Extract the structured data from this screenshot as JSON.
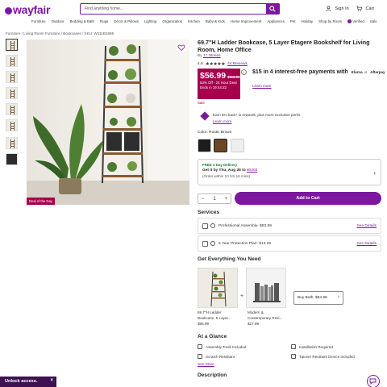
{
  "header": {
    "logo": "wayfair",
    "search_placeholder": "Find anything home...",
    "sign_in": "Sign In",
    "cart": "Cart"
  },
  "nav": [
    "Furniture",
    "Outdoor",
    "Bedding & Bath",
    "Rugs",
    "Décor & Pillows",
    "Lighting",
    "Organization",
    "Kitchen",
    "Baby & Kids",
    "Home Improvement",
    "Appliances",
    "Pet",
    "Holiday",
    "Shop by Room",
    "Verified",
    "Sale"
  ],
  "breadcrumb": "Furniture / Living Room Furniture / Bookcases / SKU: W111B1685",
  "product": {
    "title": "69.7\"H Ladder Bookcase, 5 Layer Etagere Bookshelf for Living Room, Home Office",
    "by_prefix": "By",
    "brand": "17 Stories",
    "rating": "4.8",
    "stars": "★★★★★",
    "reviews": "44 Reviews",
    "price": "$56.99",
    "old_price": "$119.99",
    "discount": "53% Off - 24 Hour Deal",
    "ends": "Ends in 19:44:22",
    "sale": "Sale",
    "installment": "$15 in 4 interest-free payments with",
    "klarna": "Klarna",
    "or": "or",
    "afterpay": "Afterpay",
    "learn_more": "Learn more",
    "rewards": "Earn 5% back* in rewards, plus more exclusive perks",
    "rewards_learn": "Learn more",
    "color_label": "Color: Rustic Brown",
    "deal_tag": "Deal of the Day",
    "qty_minus": "−",
    "qty": "1",
    "qty_plus": "+",
    "add_to_cart": "Add to Cart"
  },
  "delivery": {
    "free": "FREE 2-Day Delivery",
    "get_it": "Get it by Thu, Aug 28 to",
    "zip": "80203",
    "order": "(Order within 10 hrs 16 mins)"
  },
  "services": {
    "title": "Services",
    "items": [
      {
        "label": "Professional Assembly- $83.99",
        "details": "See Details"
      },
      {
        "label": "5 Year Protection Plan- $13.29",
        "details": "See Details"
      }
    ]
  },
  "bundle": {
    "title": "Get Everything You Need",
    "item1": {
      "name1": "69.7\"H Ladder",
      "name2": "Bookcase, 5 Layer...",
      "price": "$56.99"
    },
    "item2": {
      "name1": "Modern &",
      "name2": "Contemporary Resi...",
      "price": "$27.99"
    },
    "plus": "+",
    "buy_both": "Buy Both: $84.98"
  },
  "glance": {
    "title": "At a Glance",
    "items": [
      "Assembly Tools Included",
      "Installation Required",
      "Scratch Resistant",
      "Tipover Restraint Device Included"
    ],
    "see_more": "See More"
  },
  "description_title": "Description",
  "promo": {
    "unlock": "Unlock access.",
    "close": "×"
  },
  "colors": {
    "brand": "#7b189f",
    "deal": "#a7004c",
    "delivery_green": "#187a34"
  }
}
